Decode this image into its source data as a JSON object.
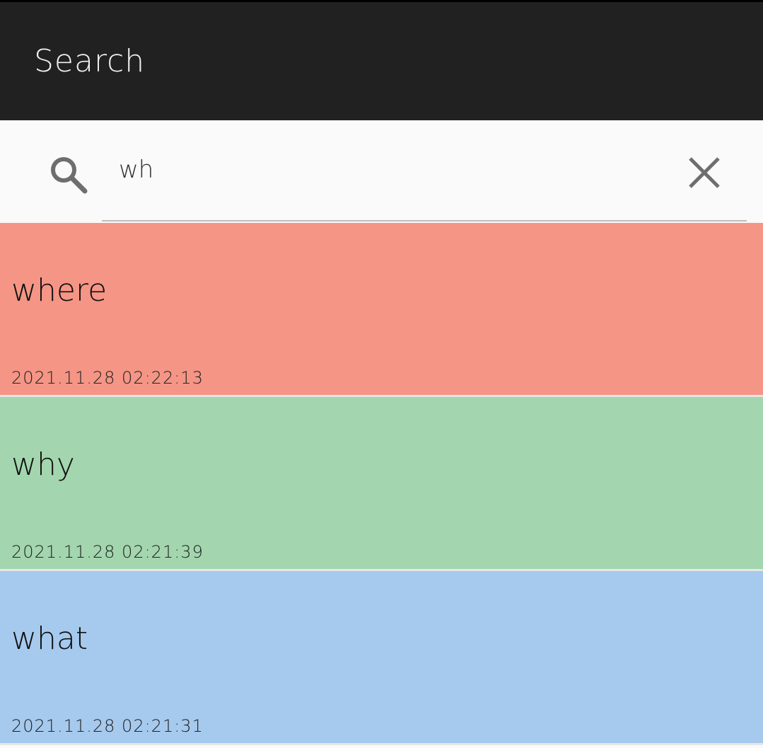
{
  "app_bar": {
    "title": "Search"
  },
  "search": {
    "value": "wh",
    "search_icon": "search-icon",
    "clear_icon": "close-icon"
  },
  "colors": {
    "app_bar_bg": "#212121",
    "item_red": "#f59585",
    "item_green": "#a3d6ae",
    "item_blue": "#a6c9ee"
  },
  "results": [
    {
      "word": "where",
      "timestamp": "2021.11.28  02:22:13",
      "color": "#f59585"
    },
    {
      "word": "why",
      "timestamp": "2021.11.28  02:21:39",
      "color": "#a3d6ae"
    },
    {
      "word": "what",
      "timestamp": "2021.11.28  02:21:31",
      "color": "#a6c9ee"
    }
  ]
}
